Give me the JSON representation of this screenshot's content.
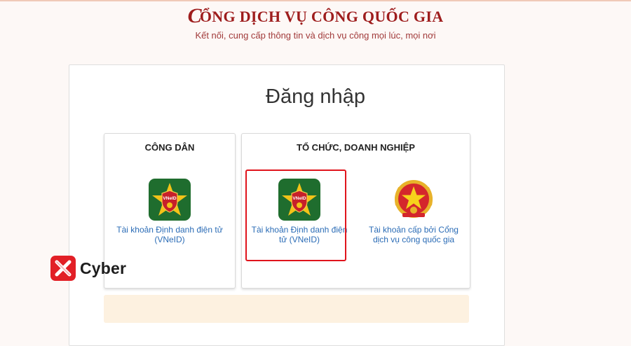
{
  "header": {
    "logo_letter": "C",
    "title_rest": "ỔNG DỊCH VỤ CÔNG QUỐC GIA",
    "subtitle": "Kết nối, cung cấp thông tin và dịch vụ công mọi lúc, mọi nơi"
  },
  "login": {
    "title": "Đăng nhập",
    "citizen": {
      "heading": "CÔNG DÂN",
      "vneid_label": "Tài khoản Định danh điện tử (VNeID)"
    },
    "organization": {
      "heading": "TỔ CHỨC, DOANH NGHIỆP",
      "vneid_label": "Tài khoản Định danh điện tử (VNeID)",
      "portal_label": "Tài khoản cấp bởi Cổng dịch vụ công quốc gia"
    }
  },
  "vneid_badge_text": "VNeID",
  "watermark": {
    "text": "Cyber"
  },
  "colors": {
    "brand_red": "#9e1d1d",
    "link_blue": "#2b6cb6",
    "highlight_red": "#e0141c",
    "vneid_green": "#1f6d2e",
    "notice_bg": "#fdf1e0"
  },
  "icons": {
    "vneid": "vneid-shield-icon",
    "portal": "national-emblem-icon",
    "watermark": "cyber-logo-icon"
  }
}
